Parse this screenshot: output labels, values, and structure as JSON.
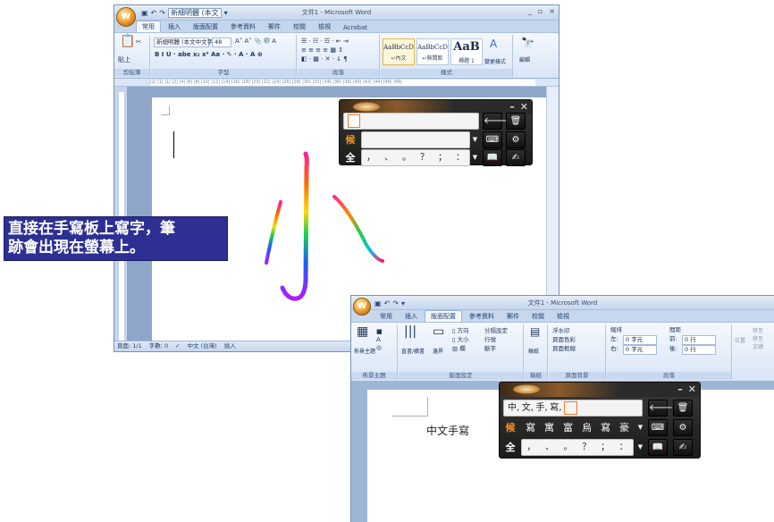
{
  "window1": {
    "title": "文件1 - Microsoft Word",
    "orb_label": "W",
    "qat": {
      "font_name": "新細明體 (本文",
      "undo": "↶",
      "redo": "↷"
    },
    "tabs": [
      "常用",
      "插入",
      "版面配置",
      "參考資料",
      "郵件",
      "校閱",
      "檢視",
      "Acrobat"
    ],
    "ribbon": {
      "paste_label": "貼上",
      "clipboard_label": "剪貼簿",
      "font_name": "新細明體 (本文中文字",
      "font_size": "48",
      "font_group_label": "字型",
      "para_group_label": "段落",
      "styles_group_label": "樣式",
      "styles": [
        {
          "sample": "AaBbCcD",
          "name": "↵內文"
        },
        {
          "sample": "AaBbCcD",
          "name": "↵無間距"
        },
        {
          "sample": "AaB",
          "name": "標題 1"
        }
      ],
      "change_styles": "變更樣式",
      "edit_label": "編輯"
    },
    "ruler_text": "|2| |1|  |1|  |2|  |4|  |6|  |8|  |10| |12| |14| |16| |18| |20| |22| |24| |26| |28| |30| |32| |34| |36| |38| |40| |42| |44| |46| |48|",
    "status": {
      "page": "頁面: 1/1",
      "words": "字數: 0",
      "language": "中文 (台灣)",
      "mode": "插入"
    },
    "handwriting": "小"
  },
  "ime_panel_1": {
    "candidate_label": "候",
    "fullwidth_label": "全",
    "symbols": [
      "，",
      "、",
      "。",
      "？",
      "；",
      "："
    ]
  },
  "annotation": {
    "line1": "直接在手寫板上寫字，筆",
    "line2": "跡會出現在螢幕上。"
  },
  "window2": {
    "title": "文件1 - Microsoft Word",
    "orb_label": "W",
    "tabs": [
      "常用",
      "插入",
      "版面配置",
      "參考資料",
      "郵件",
      "校閱",
      "檢視"
    ],
    "ribbon": {
      "theme_label": "佈景主題",
      "page_setup_label": "版面設定",
      "bg_label": "稿紙",
      "page_bg_label": "頁面背景",
      "paragraph_label": "段落",
      "orientation": "方向",
      "size": "大小",
      "columns": "欄",
      "margins": "邊界",
      "text_direction": "直書/橫書",
      "breaks": "分隔設定",
      "line_numbers": "行號",
      "hyphenation": "斷字",
      "watermark": "浮水印",
      "page_color": "頁面色彩",
      "page_borders": "頁面框線",
      "indent_label": "縮排",
      "spacing_label": "間距",
      "indent_left": "0 字元",
      "indent_right": "0 字元",
      "spacing_before": "0 行",
      "spacing_after": "0 行",
      "left_label": "左:",
      "right_label": "右:",
      "before_label": "前:",
      "after_label": "後:",
      "position": "位置",
      "arrange_1": "移至",
      "arrange_2": "移至",
      "arrange_3": "文繞"
    },
    "doc_text": "中文手寫"
  },
  "ime_panel_2": {
    "composed": [
      "中",
      "文",
      "手",
      "寫"
    ],
    "candidate_label": "候",
    "candidates": [
      "寫",
      "寓",
      "富",
      "烏",
      "寫",
      "豪"
    ],
    "fullwidth_label": "全",
    "symbols": [
      "，",
      "、",
      "。",
      "？",
      "；",
      "："
    ]
  }
}
